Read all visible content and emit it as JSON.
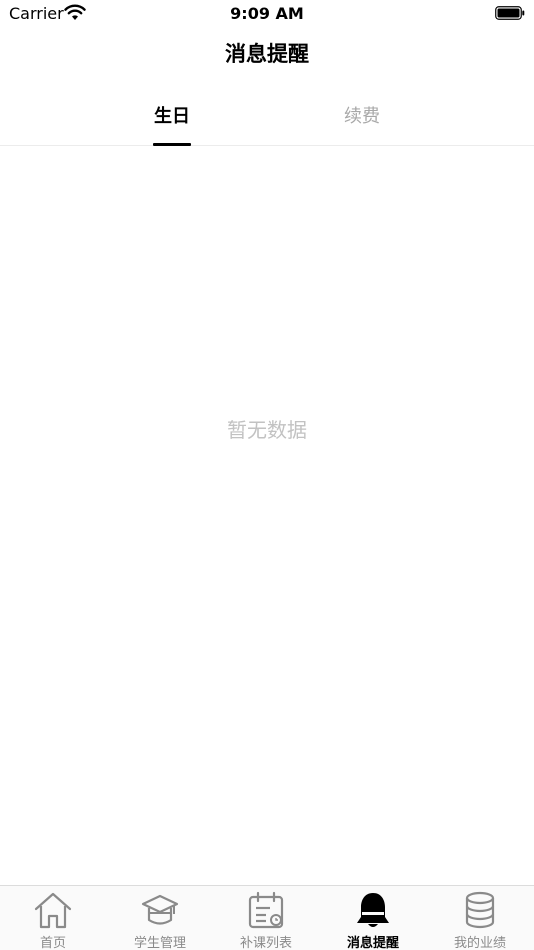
{
  "status_bar": {
    "carrier": "Carrier",
    "time": "9:09 AM"
  },
  "nav": {
    "title": "消息提醒"
  },
  "tabs": [
    {
      "label": "生日",
      "active": true
    },
    {
      "label": "续费",
      "active": false
    }
  ],
  "empty_state": {
    "text": "暂无数据"
  },
  "tab_bar": {
    "items": [
      {
        "label": "首页",
        "icon": "home-icon",
        "selected": false
      },
      {
        "label": "学生管理",
        "icon": "graduation-cap-icon",
        "selected": false
      },
      {
        "label": "补课列表",
        "icon": "calendar-list-icon",
        "selected": false
      },
      {
        "label": "消息提醒",
        "icon": "bell-icon",
        "selected": true
      },
      {
        "label": "我的业绩",
        "icon": "database-icon",
        "selected": false
      }
    ]
  },
  "colors": {
    "active": "#000000",
    "inactive": "#a8a8a8",
    "empty_text": "#c2c2c2",
    "tab_bar_label": "#8a8a8a"
  }
}
